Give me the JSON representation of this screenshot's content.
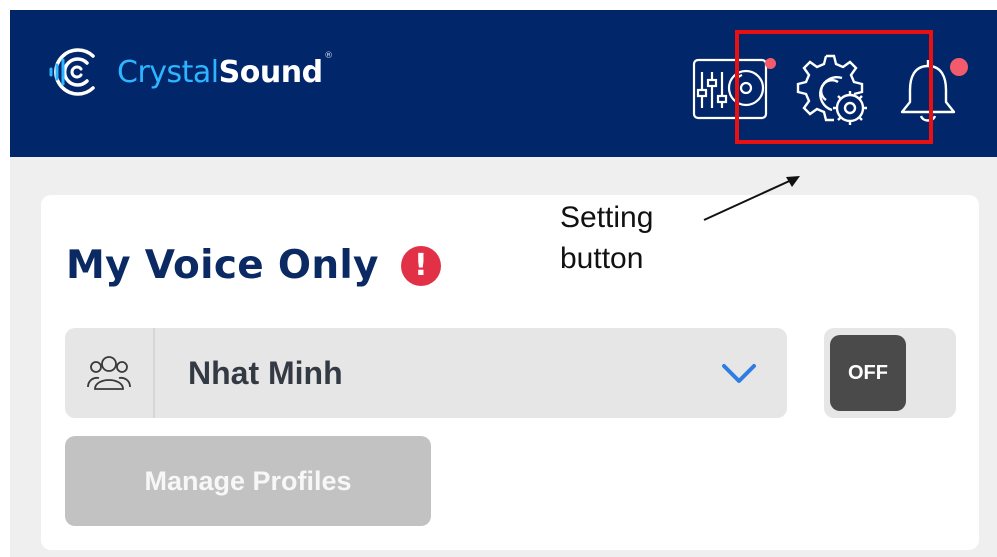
{
  "app": {
    "brand": {
      "crystal": "Crystal",
      "sound": "Sound",
      "mark": "®"
    },
    "header_icons": [
      {
        "name": "mixer-player-icon",
        "has_notification": true
      },
      {
        "name": "settings-gear-icon",
        "has_notification": false
      },
      {
        "name": "bell-icon",
        "has_notification": true
      }
    ],
    "colors": {
      "header_bg": "#02266a",
      "brand_blue": "#2db5ff",
      "notification": "#f25b6c",
      "highlight": "#e81010",
      "title": "#0b2a63",
      "warning": "#e23046"
    }
  },
  "card": {
    "title": "My Voice Only",
    "warning_glyph": "!",
    "profile": {
      "selected": "Nhat Minh",
      "icon": "people-group-icon"
    },
    "toggle": {
      "label": "OFF"
    },
    "manage_button": "Manage Profiles"
  },
  "annotation": {
    "line1": "Setting",
    "line2": "button"
  }
}
